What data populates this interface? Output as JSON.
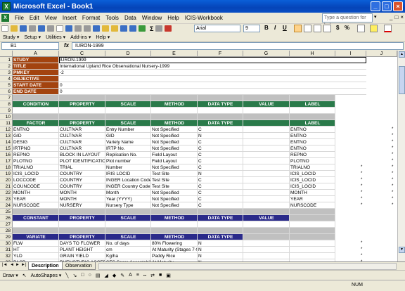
{
  "window": {
    "title": "Microsoft Excel - Book1",
    "app_icon": "X",
    "buttons": [
      "_",
      "□",
      "×"
    ]
  },
  "menu": {
    "items": [
      "File",
      "Edit",
      "View",
      "Insert",
      "Format",
      "Tools",
      "Data",
      "Window",
      "Help",
      "ICIS-Workbook"
    ],
    "help_placeholder": "Type a question for help",
    "mdi_buttons": [
      "_",
      "□",
      "×"
    ]
  },
  "formatting": {
    "font": "Arial",
    "size": "9",
    "bold": "B",
    "italic": "I",
    "underline": "U",
    "currency": "$",
    "percent": "%"
  },
  "toolbar2": [
    "Study ▾",
    "Setup ▾",
    "Utilities ▾",
    "Add-ins ▾",
    "Help ▾"
  ],
  "formula_bar": {
    "name_box": "B1",
    "fx": "fx",
    "value": "IURON-1999"
  },
  "columns": [
    "A",
    "C",
    "D",
    "E",
    "F",
    "G",
    "H",
    "I",
    "J"
  ],
  "row_numbers": [
    "1",
    "2",
    "3",
    "4",
    "5",
    "6",
    "7",
    "8",
    "9",
    "10",
    "11",
    "12",
    "13",
    "14",
    "15",
    "16",
    "17",
    "18",
    "19",
    "20",
    "21",
    "22",
    "23",
    "24",
    "25",
    "26",
    "27",
    "28",
    "29",
    "30",
    "31",
    "32",
    "33"
  ],
  "study": [
    {
      "key": "STUDY",
      "value": "IURON-1999"
    },
    {
      "key": "TITLE",
      "value": "International Upland Rice Observational Nursery-1999"
    },
    {
      "key": "PMKEY",
      "value": "-2"
    },
    {
      "key": "OBJECTIVE",
      "value": ""
    },
    {
      "key": "START DATE",
      "value": "0"
    },
    {
      "key": "END DATE",
      "value": "0"
    }
  ],
  "condition_header": [
    "CONDITION",
    "PROPERTY",
    "SCALE",
    "METHOD",
    "DATA TYPE",
    "VALUE",
    "LABEL"
  ],
  "factor_header": [
    "FACTOR",
    "PROPERTY",
    "SCALE",
    "METHOD",
    "DATA TYPE",
    "",
    "LABEL"
  ],
  "factors": [
    [
      "ENTNO",
      "CULTIVAR",
      "Entry Number",
      "Not Specified",
      "C",
      "",
      "ENTNO",
      "",
      "*"
    ],
    [
      "GID",
      "CULTIVAR",
      "GID",
      "Not Specified",
      "N",
      "",
      "ENTNO",
      "",
      "*"
    ],
    [
      "DESIG",
      "CULTIVAR",
      "Variety Name",
      "Not Specified",
      "C",
      "",
      "ENTNO",
      "",
      "*"
    ],
    [
      "IRTPNO",
      "CULTIVAR",
      "IRTP No.",
      "Not Specified",
      "C",
      "",
      "ENTNO",
      "",
      "*"
    ],
    [
      "REPNO",
      "BLOCK IN LAYOUT",
      "Replication No.",
      "Field Layout",
      "C",
      "",
      "REPNO",
      "",
      "*"
    ],
    [
      "PLOTNO",
      "PLOT IDENTIFICATION",
      "Plot number",
      "Field Layout",
      "C",
      "",
      "PLOTNO",
      "",
      "*"
    ],
    [
      "TRIALNO",
      "TRIAL",
      "Number",
      "Not Specified",
      "C",
      "",
      "TRIALNO",
      "*",
      "*"
    ],
    [
      "ICIS_LOCID",
      "COUNTRY",
      "IRIS LOCID",
      "Test Site",
      "N",
      "",
      "ICIS_LOCID",
      "*",
      "*"
    ],
    [
      "LOCCODE",
      "COUNTRY",
      "INGER Location Code",
      "Test Site",
      "C",
      "",
      "ICIS_LOCID",
      "*",
      "*"
    ],
    [
      "COUNCODE",
      "COUNTRY",
      "INGER Country Code",
      "Test Site",
      "C",
      "",
      "ICIS_LOCID",
      "*",
      "*"
    ],
    [
      "MONTH",
      "MONTH",
      "Month",
      "Not Specified",
      "C",
      "",
      "MONTH",
      "*",
      "*"
    ],
    [
      "YEAR",
      "MONTH",
      "Year (YYYY)",
      "Not Specified",
      "C",
      "",
      "YEAR",
      "*",
      "*"
    ],
    [
      "NURSCODE",
      "NURSERY",
      "Nursery Type",
      "Not Specified",
      "C",
      "",
      "NURSCODE",
      "*",
      "*"
    ]
  ],
  "constant_header": [
    "CONSTANT",
    "PROPERTY",
    "SCALE",
    "METHOD",
    "DATA TYPE",
    "VALUE",
    ""
  ],
  "variate_header": [
    "VARIATE",
    "PROPERTY",
    "SCALE",
    "METHOD",
    "DATA TYPE",
    "",
    ""
  ],
  "variates": [
    [
      "FLW",
      "DAYS TO FLOWER",
      "No. of days",
      "80% Flowering",
      "N",
      "",
      "",
      "*",
      ""
    ],
    [
      "HT",
      "PLANT HEIGHT",
      "cm",
      "At Maturity (Stages 7-9)",
      "N",
      "",
      "",
      "*",
      ""
    ],
    [
      "YLD",
      "GRAIN YIELD",
      "Kg/ha",
      "Paddy Rice",
      "N",
      "",
      "",
      "*",
      ""
    ],
    [
      "PACP",
      "PHENOTYPIC ACCEPTABILITY",
      "SES Score Acceptability",
      "At Maturity",
      "N",
      "",
      "",
      "*",
      ""
    ]
  ],
  "sheet_tabs": [
    "Description",
    "Observation"
  ],
  "tab_nav": [
    "|◄",
    "◄",
    "►",
    "►|"
  ],
  "drawbar": [
    "Draw ▾",
    "AutoShapes ▾"
  ],
  "status": {
    "ready": "",
    "num": "NUM"
  }
}
